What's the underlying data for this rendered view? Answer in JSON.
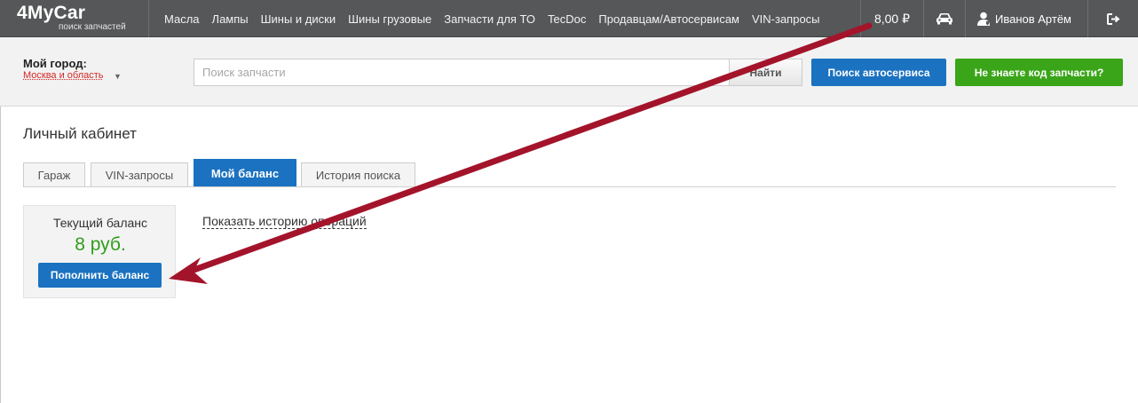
{
  "header": {
    "logo_main": "4MyCar",
    "logo_sub": "поиск запчастей",
    "nav": [
      {
        "label": "Масла"
      },
      {
        "label": "Лампы"
      },
      {
        "label": "Шины и диски"
      },
      {
        "label": "Шины грузовые"
      },
      {
        "label": "Запчасти для ТО"
      },
      {
        "label": "TecDoc"
      },
      {
        "label": "Продавцам/Автосервисам"
      },
      {
        "label": "VIN-запросы"
      }
    ],
    "balance": "8,00 ₽",
    "car_icon": "car-icon",
    "user_icon": "user-icon",
    "user_name": "Иванов Артём",
    "logout_icon": "logout-icon"
  },
  "search": {
    "city_label": "Мой город:",
    "city_value": "Москва и область",
    "placeholder": "Поиск запчасти",
    "value": "",
    "find_label": "Найти",
    "autoservice_label": "Поиск автосервиса",
    "unknown_code_label": "Не знаете код запчасти?"
  },
  "page": {
    "title": "Личный кабинет",
    "tabs": [
      {
        "label": "Гараж",
        "active": false
      },
      {
        "label": "VIN-запросы",
        "active": false
      },
      {
        "label": "Мой баланс",
        "active": true
      },
      {
        "label": "История поиска",
        "active": false
      }
    ]
  },
  "balance_card": {
    "label": "Текущий баланс",
    "amount": "8 руб.",
    "topup_label": "Пополнить баланс"
  },
  "history_link": "Показать историю операций",
  "colors": {
    "topbar": "#555759",
    "primary": "#1b72c0",
    "success": "#3aa518",
    "amount": "#2f9e1b",
    "city": "#d62828",
    "annotation_arrow": "#a3142b"
  }
}
